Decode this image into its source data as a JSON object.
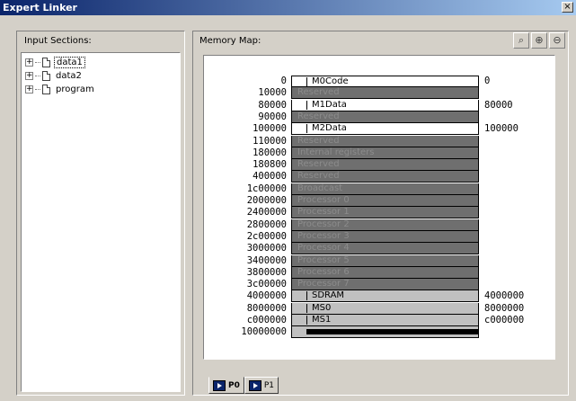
{
  "window": {
    "title": "Expert Linker",
    "close_label": "×"
  },
  "input_sections": {
    "label": "Input Sections:",
    "items": [
      {
        "label": "data1",
        "expander": "+"
      },
      {
        "label": "data2",
        "expander": "+"
      },
      {
        "label": "program",
        "expander": "+"
      }
    ]
  },
  "memory_map": {
    "label": "Memory Map:",
    "toolbar": {
      "zoom_fit_icon": "⌕",
      "zoom_in_icon": "⊕",
      "zoom_out_icon": "⊖"
    },
    "rows": [
      {
        "start": "0",
        "name": "M0Code",
        "style": "white",
        "right": "0"
      },
      {
        "start": "10000",
        "name": "Reserved",
        "style": "reserved",
        "right": ""
      },
      {
        "start": "80000",
        "name": "M1Data",
        "style": "white",
        "right": "80000"
      },
      {
        "start": "90000",
        "name": "Reserved",
        "style": "reserved",
        "right": ""
      },
      {
        "start": "100000",
        "name": "M2Data",
        "style": "white",
        "right": "100000"
      },
      {
        "start": "110000",
        "name": "Reserved",
        "style": "reserved",
        "right": ""
      },
      {
        "start": "180000",
        "name": "Internal registers",
        "style": "reserved",
        "right": ""
      },
      {
        "start": "180800",
        "name": "Reserved",
        "style": "reserved",
        "right": ""
      },
      {
        "start": "400000",
        "name": "Reserved",
        "style": "reserved",
        "right": ""
      },
      {
        "start": "1c00000",
        "name": "Broadcast",
        "style": "reserved",
        "right": ""
      },
      {
        "start": "2000000",
        "name": "Processor 0",
        "style": "reserved",
        "right": ""
      },
      {
        "start": "2400000",
        "name": "Processor 1",
        "style": "reserved",
        "right": ""
      },
      {
        "start": "2800000",
        "name": "Processor 2",
        "style": "reserved",
        "right": ""
      },
      {
        "start": "2c00000",
        "name": "Processor 3",
        "style": "reserved",
        "right": ""
      },
      {
        "start": "3000000",
        "name": "Processor 4",
        "style": "reserved",
        "right": ""
      },
      {
        "start": "3400000",
        "name": "Processor 5",
        "style": "reserved",
        "right": ""
      },
      {
        "start": "3800000",
        "name": "Processor 6",
        "style": "reserved",
        "right": ""
      },
      {
        "start": "3c00000",
        "name": "Processor 7",
        "style": "reserved",
        "right": ""
      },
      {
        "start": "4000000",
        "name": "SDRAM",
        "style": "light",
        "right": "4000000"
      },
      {
        "start": "8000000",
        "name": "MS0",
        "style": "light",
        "right": "8000000"
      },
      {
        "start": "c000000",
        "name": "MS1",
        "style": "light",
        "right": "c000000"
      },
      {
        "start": "10000000",
        "name": "",
        "style": "end",
        "right": ""
      }
    ]
  },
  "tabs": [
    {
      "label": "P0",
      "active": true
    },
    {
      "label": "P1",
      "active": false
    }
  ]
}
